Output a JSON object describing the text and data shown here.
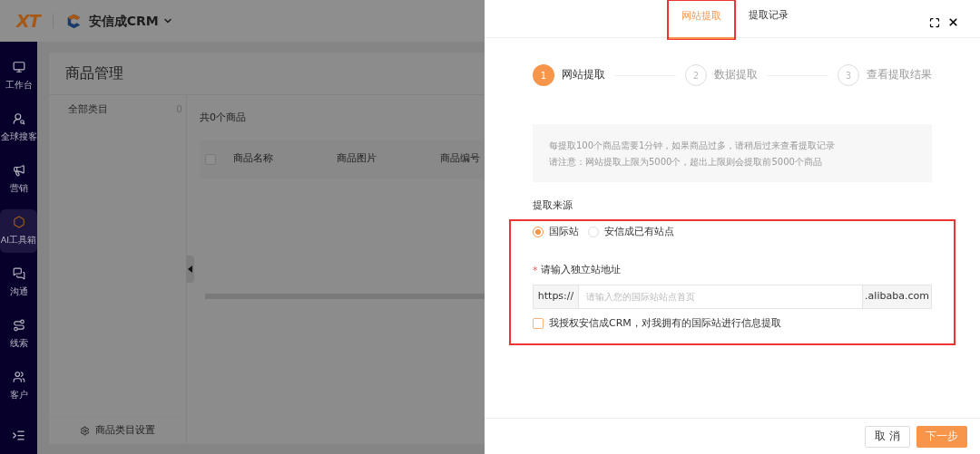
{
  "brand": {
    "logo": "XT",
    "product": "安信成CRM"
  },
  "nav": [
    {
      "label": "工作台",
      "selected": false
    },
    {
      "label": "全球搜客",
      "selected": false
    },
    {
      "label": "营销",
      "selected": false
    },
    {
      "label": "AI工具箱",
      "selected": true
    },
    {
      "label": "沟通",
      "selected": false
    },
    {
      "label": "线索",
      "selected": false
    },
    {
      "label": "客户",
      "selected": false
    }
  ],
  "page": {
    "title": "商品管理",
    "select_all_checked": false,
    "categories": [
      {
        "label": "全部类目",
        "count": "0"
      }
    ],
    "category_settings": "商品类目设置",
    "total": "共0个商品",
    "columns": [
      "商品名称",
      "商品图片",
      "商品编号"
    ]
  },
  "drawer": {
    "tabs": [
      {
        "label": "网站提取",
        "selected": true
      },
      {
        "label": "提取记录",
        "selected": false
      }
    ],
    "steps": [
      {
        "number": "1",
        "label": "网站提取",
        "selected": true
      },
      {
        "number": "2",
        "label": "数据提取",
        "selected": false
      },
      {
        "number": "3",
        "label": "查看提取结果",
        "selected": false
      }
    ],
    "notice": [
      "每提取100个商品需要1分钟，如果商品过多，请稍后过来查看提取记录",
      "请注意：网站提取上限为5000个，超出上限则会提取前5000个商品"
    ],
    "source_label": "提取来源",
    "source_options": [
      {
        "label": "国际站",
        "selected": true
      },
      {
        "label": "安信成已有站点",
        "selected": false
      }
    ],
    "url_label": "请输入独立站地址",
    "required_mark": "*",
    "url_prefix": "https://",
    "url_placeholder": "请输入您的国际站站点首页",
    "url_suffix": ".alibaba.com",
    "consent": {
      "label": "我授权安信成CRM，对我拥有的国际站进行信息提取",
      "checked": false
    },
    "buttons": [
      {
        "label": "取 消",
        "kind": "secondary"
      },
      {
        "label": "下一步",
        "kind": "primary"
      }
    ]
  }
}
